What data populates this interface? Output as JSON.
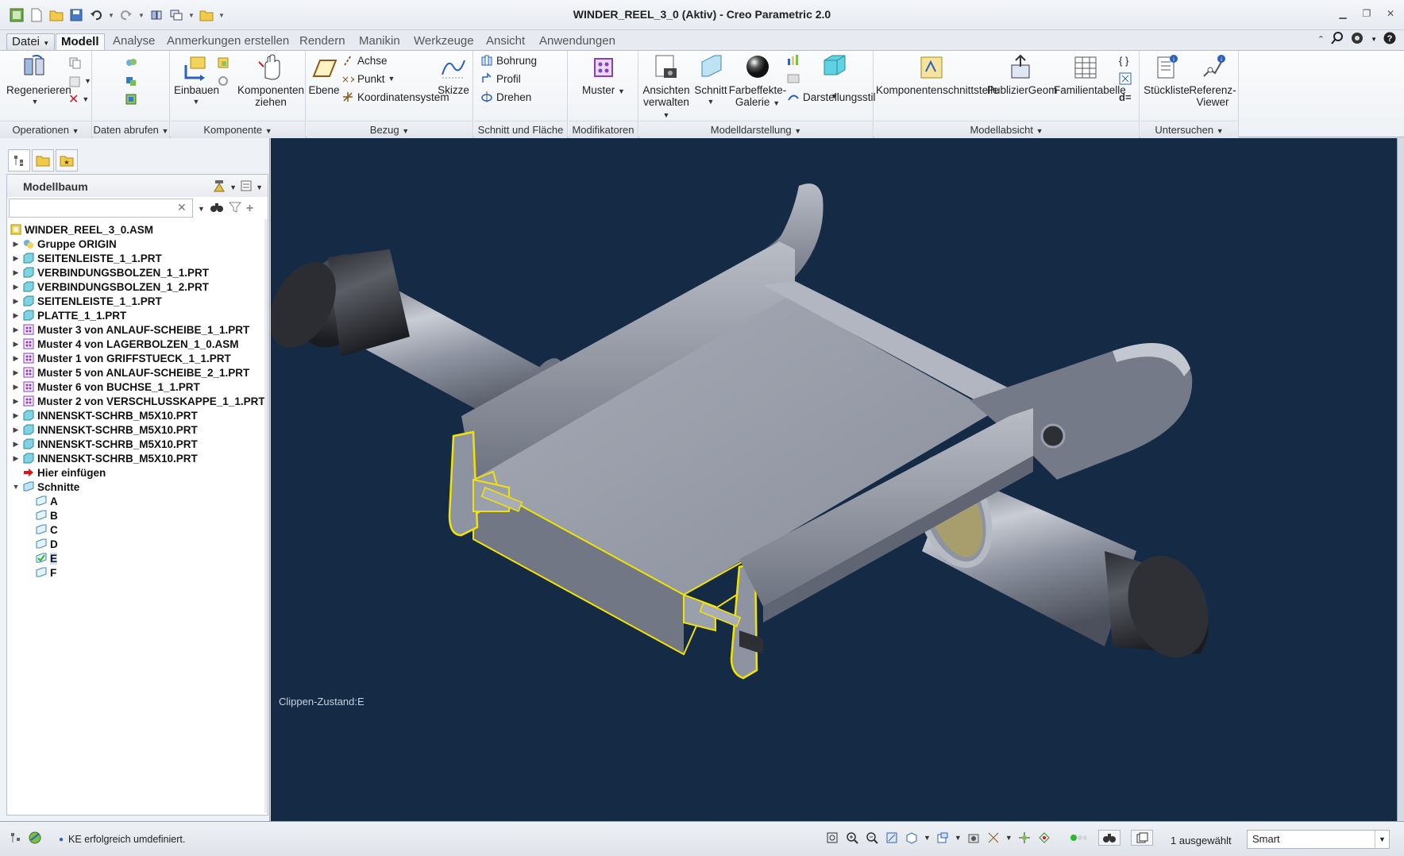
{
  "window": {
    "title": "WINDER_REEL_3_0 (Aktiv) - Creo Parametric 2.0"
  },
  "tabs": [
    {
      "label": "Datei"
    },
    {
      "label": "Modell"
    },
    {
      "label": "Analyse"
    },
    {
      "label": "Anmerkungen erstellen"
    },
    {
      "label": "Rendern"
    },
    {
      "label": "Manikin"
    },
    {
      "label": "Werkzeuge"
    },
    {
      "label": "Ansicht"
    },
    {
      "label": "Anwendungen"
    }
  ],
  "ribbon": {
    "groups": [
      {
        "label": "Operationen"
      },
      {
        "label": "Daten abrufen"
      },
      {
        "label": "Komponente"
      },
      {
        "label": "Bezug"
      },
      {
        "label": "Schnitt und Fläche"
      },
      {
        "label": "Modifikatoren"
      },
      {
        "label": "Modelldarstellung"
      },
      {
        "label": "Modellabsicht"
      },
      {
        "label": "Untersuchen"
      }
    ],
    "regenerieren": "Regenerieren",
    "einbauen": "Einbauen",
    "komponenten_ziehen_1": "Komponenten",
    "komponenten_ziehen_2": "ziehen",
    "ebene": "Ebene",
    "achse": "Achse",
    "punkt": "Punkt",
    "koordinatensystem": "Koordinatensystem",
    "skizze": "Skizze",
    "bohrung": "Bohrung",
    "profil": "Profil",
    "drehen": "Drehen",
    "muster": "Muster",
    "ansichten_1": "Ansichten",
    "ansichten_2": "verwalten",
    "schnitt": "Schnitt",
    "farbeffekte_1": "Farbeffekte-",
    "farbeffekte_2": "Galerie",
    "darstellungsstil": "Darstellungsstil",
    "komponentenschnittstelle": "Komponentenschnittstelle",
    "publiziergeom": "PublizierGeom",
    "familientabelle": "Familientabelle",
    "dformula": "d=",
    "stueckliste": "Stückliste",
    "referenz_1": "Referenz-",
    "referenz_2": "Viewer"
  },
  "modeltree": {
    "title": "Modellbaum",
    "search_value": "",
    "items": [
      {
        "label": "WINDER_REEL_3_0.ASM",
        "icon": "assembly-icon",
        "level": 0,
        "toggle": ""
      },
      {
        "label": "Gruppe ORIGIN",
        "icon": "group-icon",
        "level": 1,
        "toggle": "▶"
      },
      {
        "label": "SEITENLEISTE_1_1.PRT",
        "icon": "part-icon",
        "level": 1,
        "toggle": "▶"
      },
      {
        "label": "VERBINDUNGSBOLZEN_1_1.PRT",
        "icon": "part-icon",
        "level": 1,
        "toggle": "▶"
      },
      {
        "label": "VERBINDUNGSBOLZEN_1_2.PRT",
        "icon": "part-icon",
        "level": 1,
        "toggle": "▶"
      },
      {
        "label": "SEITENLEISTE_1_1.PRT",
        "icon": "part-icon",
        "level": 1,
        "toggle": "▶"
      },
      {
        "label": "PLATTE_1_1.PRT",
        "icon": "part-icon",
        "level": 1,
        "toggle": "▶"
      },
      {
        "label": "Muster 3 von ANLAUF-SCHEIBE_1_1.PRT",
        "icon": "pattern-icon",
        "level": 1,
        "toggle": "▶"
      },
      {
        "label": "Muster 4 von LAGERBOLZEN_1_0.ASM",
        "icon": "pattern-icon",
        "level": 1,
        "toggle": "▶"
      },
      {
        "label": "Muster 1 von GRIFFSTUECK_1_1.PRT",
        "icon": "pattern-icon",
        "level": 1,
        "toggle": "▶"
      },
      {
        "label": "Muster 5 von ANLAUF-SCHEIBE_2_1.PRT",
        "icon": "pattern-icon",
        "level": 1,
        "toggle": "▶"
      },
      {
        "label": "Muster 6 von BUCHSE_1_1.PRT",
        "icon": "pattern-icon",
        "level": 1,
        "toggle": "▶"
      },
      {
        "label": "Muster 2 von VERSCHLUSSKAPPE_1_1.PRT",
        "icon": "pattern-icon",
        "level": 1,
        "toggle": "▶"
      },
      {
        "label": "INNENSKT-SCHRB_M5X10.PRT",
        "icon": "part-icon",
        "level": 1,
        "toggle": "▶"
      },
      {
        "label": "INNENSKT-SCHRB_M5X10.PRT",
        "icon": "part-icon",
        "level": 1,
        "toggle": "▶"
      },
      {
        "label": "INNENSKT-SCHRB_M5X10.PRT",
        "icon": "part-icon",
        "level": 1,
        "toggle": "▶"
      },
      {
        "label": "INNENSKT-SCHRB_M5X10.PRT",
        "icon": "part-icon",
        "level": 1,
        "toggle": "▶"
      },
      {
        "label": "Hier einfügen",
        "icon": "insert-arrow-icon",
        "level": 1,
        "toggle": ""
      },
      {
        "label": "Schnitte",
        "icon": "sections-folder-icon",
        "level": 1,
        "toggle": "▼"
      },
      {
        "label": "A",
        "icon": "section-icon",
        "level": 2,
        "toggle": ""
      },
      {
        "label": "B",
        "icon": "section-icon",
        "level": 2,
        "toggle": ""
      },
      {
        "label": "C",
        "icon": "section-icon",
        "level": 2,
        "toggle": ""
      },
      {
        "label": "D",
        "icon": "section-icon",
        "level": 2,
        "toggle": ""
      },
      {
        "label": "E",
        "icon": "section-active-icon",
        "level": 2,
        "toggle": "",
        "selected": true
      },
      {
        "label": "F",
        "icon": "section-icon",
        "level": 2,
        "toggle": ""
      }
    ]
  },
  "viewport": {
    "clip_state_label": "Clippen-Zustand:E"
  },
  "status": {
    "message": "KE erfolgreich umdefiniert.",
    "selected_count": "1 ausgewählt",
    "filter_value": "Smart"
  },
  "colors": {
    "viewport_bg": "#142a45",
    "section_highlight": "#f2e400",
    "model_gray": "#8d93a0"
  }
}
